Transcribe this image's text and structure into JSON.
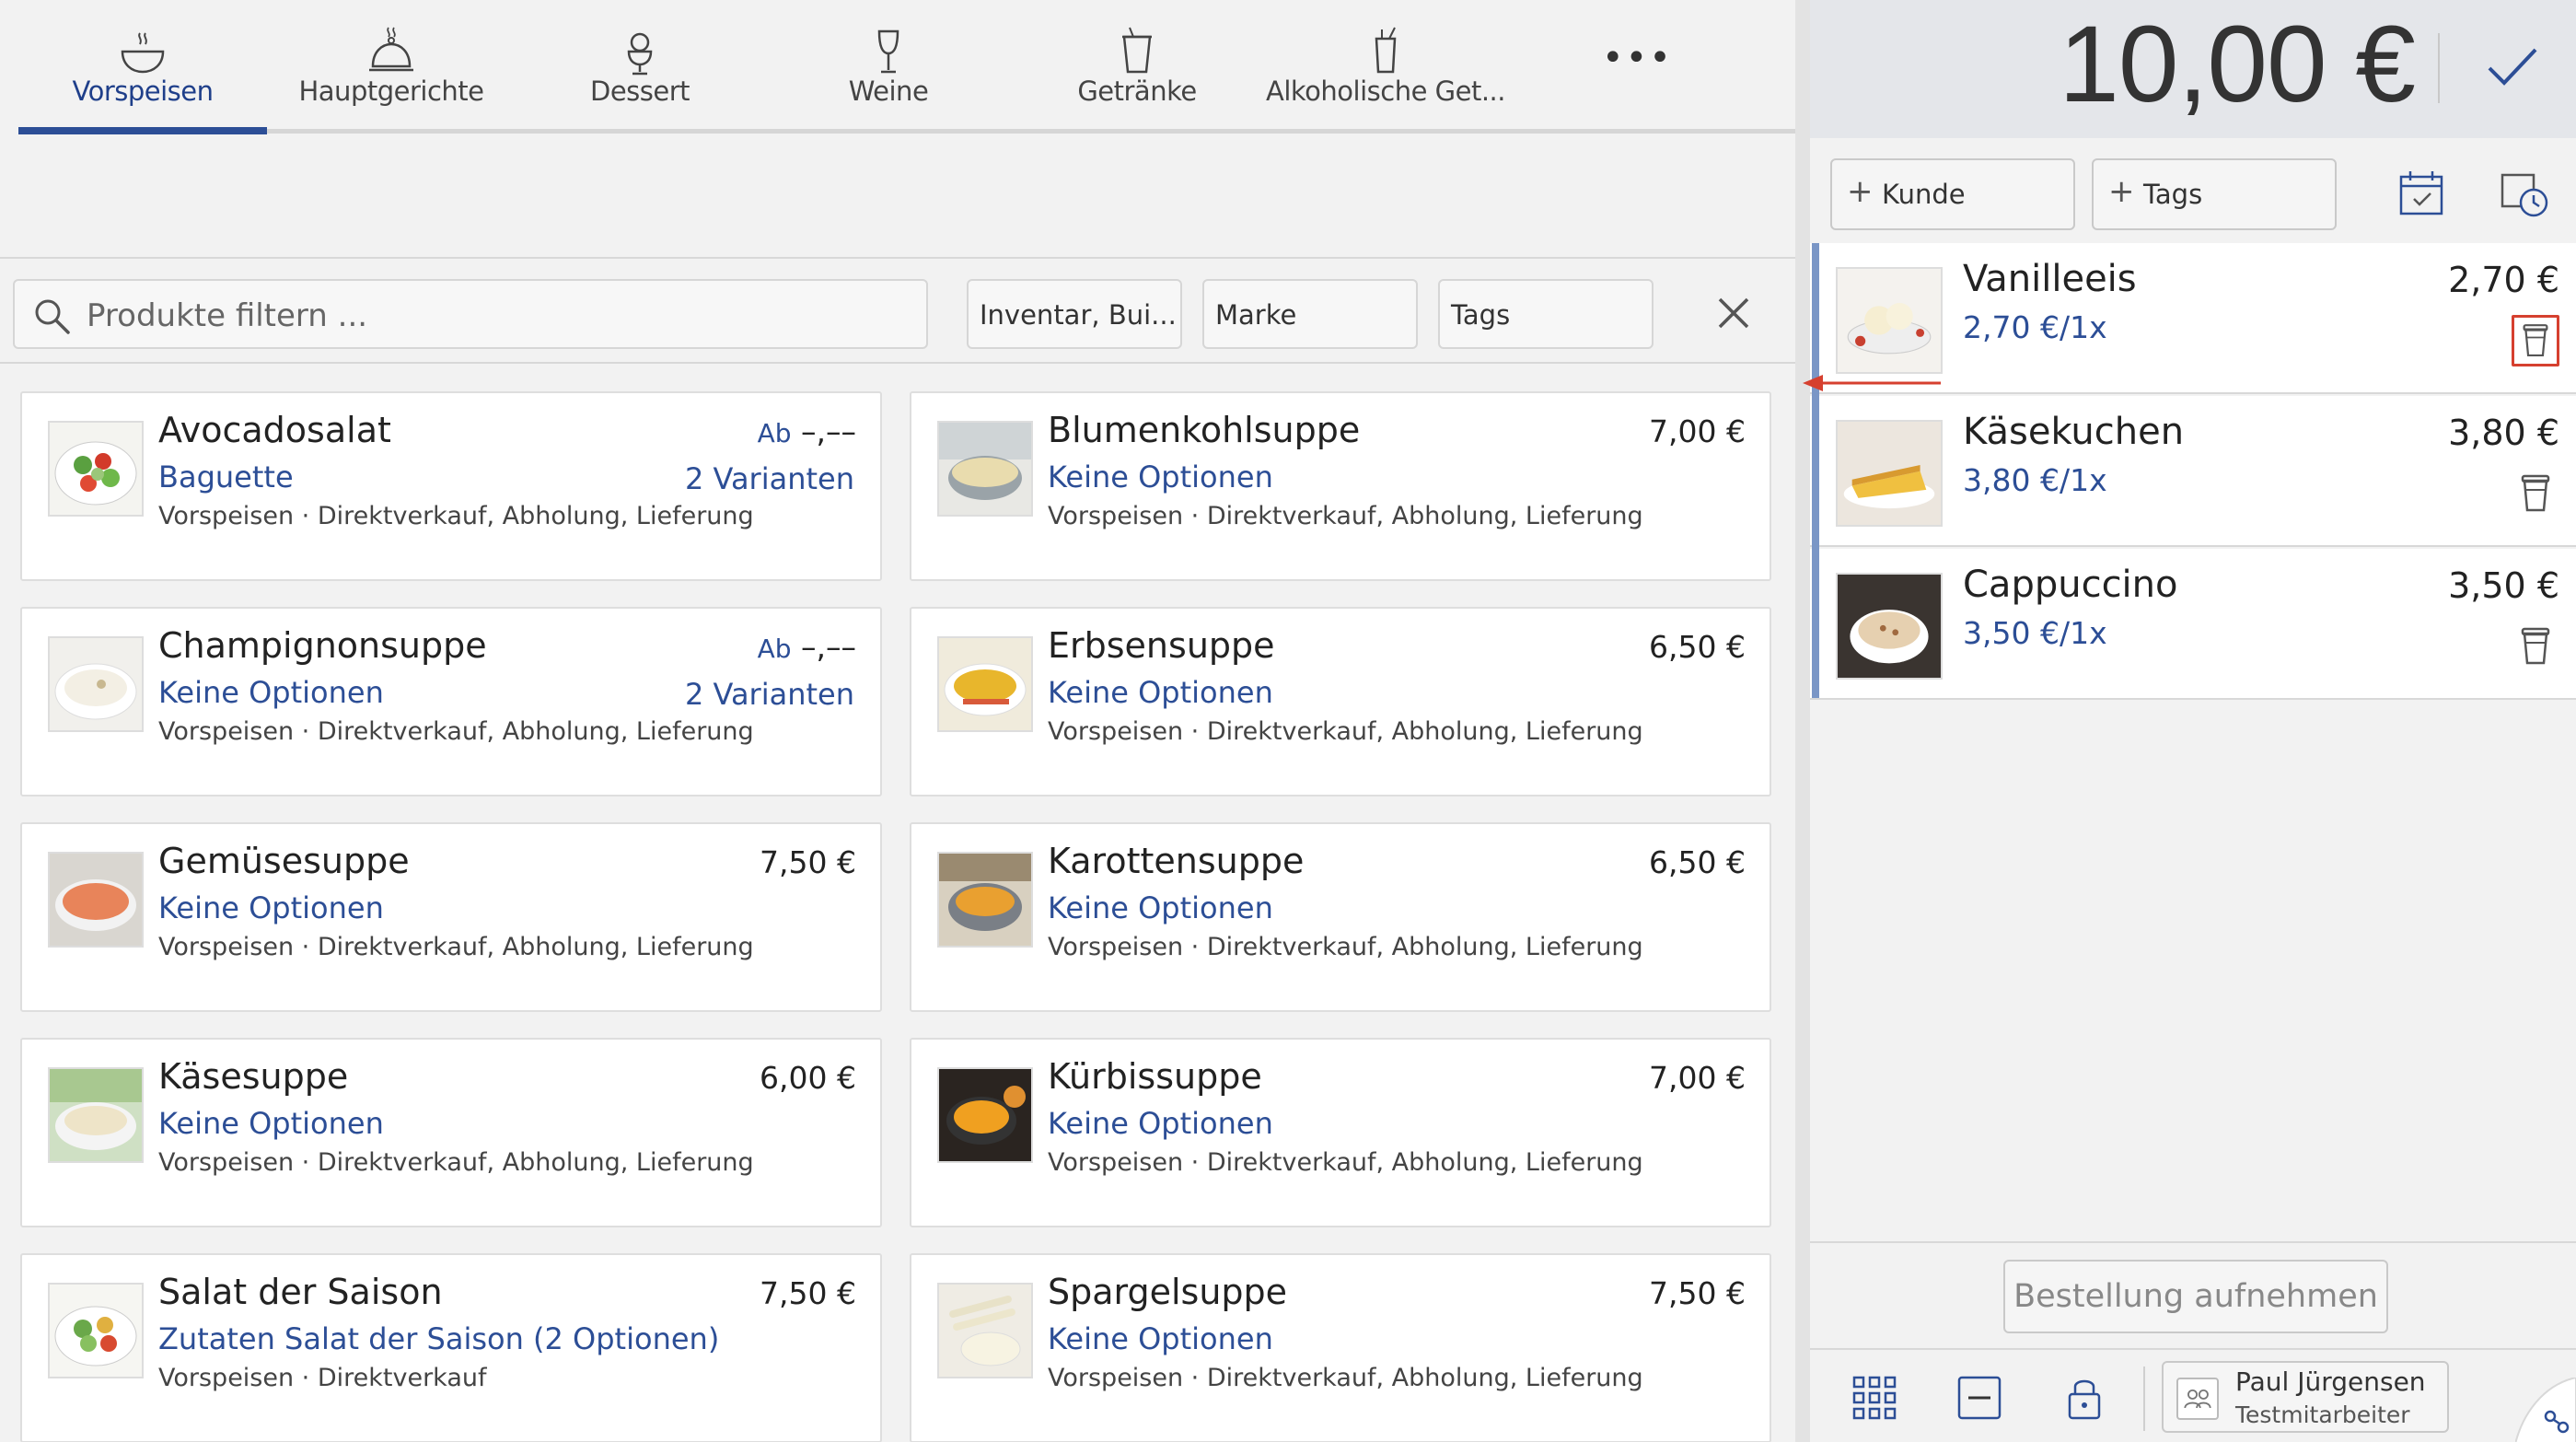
{
  "categories": [
    {
      "label": "Vorspeisen",
      "icon": "soup-bowl-icon"
    },
    {
      "label": "Hauptgerichte",
      "icon": "cloche-icon"
    },
    {
      "label": "Dessert",
      "icon": "ice-cream-icon"
    },
    {
      "label": "Weine",
      "icon": "wine-glass-icon"
    },
    {
      "label": "Getränke",
      "icon": "cup-icon"
    },
    {
      "label": "Alkoholische Get...",
      "icon": "cocktail-icon"
    }
  ],
  "more_label": "•••",
  "search": {
    "placeholder": "Produkte filtern ..."
  },
  "filters": {
    "inventory": "Inventar, Bui...",
    "brand": "Marke",
    "tags": "Tags"
  },
  "products": [
    {
      "name": "Avocadosalat",
      "option": "Baguette",
      "meta": "Vorspeisen · Direktverkauf, Abholung, Lieferung",
      "price_prefix": "Ab",
      "price": "–,––",
      "variants": "2 Varianten"
    },
    {
      "name": "Blumenkohlsuppe",
      "option": "Keine Optionen",
      "meta": "Vorspeisen · Direktverkauf, Abholung, Lieferung",
      "price_prefix": "",
      "price": "7,00 €",
      "variants": ""
    },
    {
      "name": "Champignonsuppe",
      "option": "Keine Optionen",
      "meta": "Vorspeisen · Direktverkauf, Abholung, Lieferung",
      "price_prefix": "Ab",
      "price": "–,––",
      "variants": "2 Varianten"
    },
    {
      "name": "Erbsensuppe",
      "option": "Keine Optionen",
      "meta": "Vorspeisen · Direktverkauf, Abholung, Lieferung",
      "price_prefix": "",
      "price": "6,50 €",
      "variants": ""
    },
    {
      "name": "Gemüsesuppe",
      "option": "Keine Optionen",
      "meta": "Vorspeisen · Direktverkauf, Abholung, Lieferung",
      "price_prefix": "",
      "price": "7,50 €",
      "variants": ""
    },
    {
      "name": "Karottensuppe",
      "option": "Keine Optionen",
      "meta": "Vorspeisen · Direktverkauf, Abholung, Lieferung",
      "price_prefix": "",
      "price": "6,50 €",
      "variants": ""
    },
    {
      "name": "Käsesuppe",
      "option": "Keine Optionen",
      "meta": "Vorspeisen · Direktverkauf, Abholung, Lieferung",
      "price_prefix": "",
      "price": "6,00 €",
      "variants": ""
    },
    {
      "name": "Kürbissuppe",
      "option": "Keine Optionen",
      "meta": "Vorspeisen · Direktverkauf, Abholung, Lieferung",
      "price_prefix": "",
      "price": "7,00 €",
      "variants": ""
    },
    {
      "name": "Salat der Saison",
      "option": "Zutaten Salat der Saison (2 Optionen)",
      "meta": "Vorspeisen · Direktverkauf",
      "price_prefix": "",
      "price": "7,50 €",
      "variants": ""
    },
    {
      "name": "Spargelsuppe",
      "option": "Keine Optionen",
      "meta": "Vorspeisen · Direktverkauf, Abholung, Lieferung",
      "price_prefix": "",
      "price": "7,50 €",
      "variants": ""
    }
  ],
  "order": {
    "total": "10,00 €",
    "customer_label": "Kunde",
    "tags_label": "Tags",
    "items": [
      {
        "name": "Vanilleeis",
        "unit": "2,70 €/1x",
        "price": "2,70 €",
        "highlighted": true
      },
      {
        "name": "Käsekuchen",
        "unit": "3,80 €/1x",
        "price": "3,80 €",
        "highlighted": false
      },
      {
        "name": "Cappuccino",
        "unit": "3,50 €/1x",
        "price": "3,50 €",
        "highlighted": false
      }
    ],
    "submit_label": "Bestellung aufnehmen"
  },
  "user": {
    "name": "Paul Jürgensen",
    "role": "Testmitarbeiter"
  },
  "colors": {
    "accent": "#2c4e96",
    "highlight": "#d6402f",
    "order_accent": "#7a96c6"
  }
}
